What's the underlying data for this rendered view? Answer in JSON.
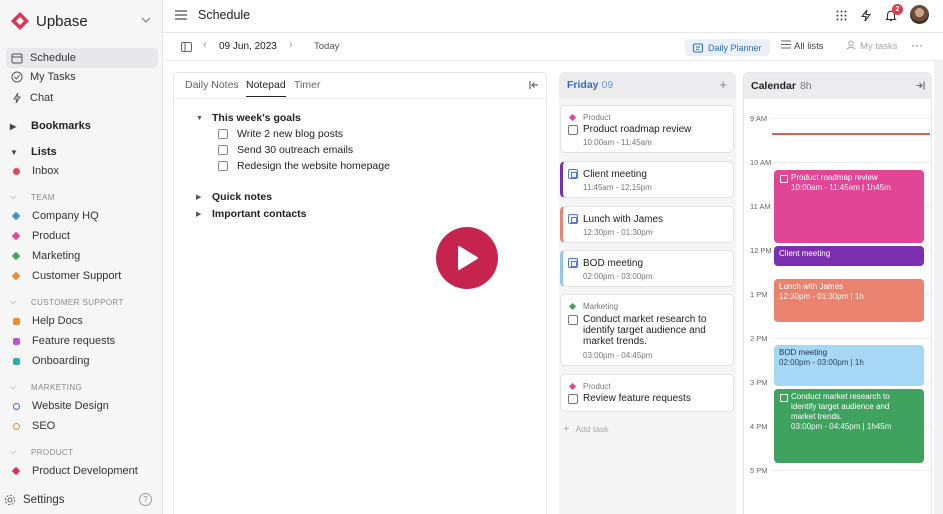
{
  "app": {
    "name": "Upbase"
  },
  "sidebar": {
    "nav": [
      {
        "label": "Schedule",
        "icon": "calendar-icon"
      },
      {
        "label": "My Tasks",
        "icon": "check-circle-icon"
      },
      {
        "label": "Chat",
        "icon": "bolt-icon"
      }
    ],
    "bookmarks_label": "Bookmarks",
    "lists_label": "Lists",
    "inbox_label": "Inbox",
    "groups": [
      {
        "label": "TEAM",
        "items": [
          "Company HQ",
          "Product",
          "Marketing",
          "Customer Support"
        ]
      },
      {
        "label": "CUSTOMER SUPPORT",
        "items": [
          "Help Docs",
          "Feature requests",
          "Onboarding"
        ]
      },
      {
        "label": "MARKETING",
        "items": [
          "Website Design",
          "SEO"
        ]
      },
      {
        "label": "PRODUCT",
        "items": [
          "Product Development"
        ]
      }
    ],
    "settings_label": "Settings",
    "help_label": "?"
  },
  "header": {
    "title": "Schedule",
    "notification_count": "2"
  },
  "subheader": {
    "date": "09 Jun, 2023",
    "today_label": "Today",
    "views": {
      "daily_planner": "Daily Planner",
      "all_lists": "All lists",
      "my_tasks": "My tasks"
    },
    "more_label": "···"
  },
  "notes": {
    "tabs": [
      "Daily Notes",
      "Notepad",
      "Timer"
    ],
    "active_tab": "Notepad",
    "goals_heading": "This week's goals",
    "goals": [
      "Write 2 new blog posts",
      "Send 30 outreach emails",
      "Redesign the website homepage"
    ],
    "quick_notes": "Quick notes",
    "important_contacts": "Important contacts"
  },
  "day": {
    "name": "Friday",
    "number": "09",
    "add_label": "+",
    "tasks": [
      {
        "tag": "Product",
        "title": "Product roadmap review",
        "time": "10:00am - 11:45am"
      },
      {
        "title": "Client meeting",
        "time": "11:45am - 12:15pm"
      },
      {
        "title": "Lunch with James",
        "time": "12:30pm - 01:30pm"
      },
      {
        "title": "BOD meeting",
        "time": "02:00pm - 03:00pm"
      },
      {
        "tag": "Marketing",
        "title_lines": [
          "Conduct market research to",
          "identify target audience and",
          "market trends."
        ],
        "time": "03:00pm - 04:45pm"
      },
      {
        "tag": "Product",
        "title": "Review feature requests"
      }
    ],
    "add_task_label": "Add task"
  },
  "calendar": {
    "title": "Calendar",
    "hours_total": "8h",
    "hours": [
      "9 AM",
      "10 AM",
      "11 AM",
      "12 PM",
      "1 PM",
      "2 PM",
      "3 PM",
      "4 PM",
      "5 PM"
    ],
    "events": [
      {
        "title": "Product roadmap review",
        "time": "10:00am - 11:45am | 1h45m"
      },
      {
        "title": "Client meeting"
      },
      {
        "title": "Lunch with James",
        "time": "12:30pm - 01:30pm | 1h"
      },
      {
        "title": "BOD meeting",
        "time": "02:00pm - 03:00pm | 1h"
      },
      {
        "title_lines": [
          "Conduct market research to",
          "identify target audience and",
          "market trends."
        ],
        "time": "03:00pm - 04:45pm | 1h45m"
      }
    ]
  },
  "colors": {
    "brand": "#d9365a",
    "accent_blue": "#2f6cc7",
    "product_event": "#e04596",
    "client_event": "#7a2fb0",
    "lunch_event": "#e9826e",
    "bod_event": "#a6d8f5",
    "research_event": "#3fa35f",
    "play_button": "#c6244f"
  }
}
